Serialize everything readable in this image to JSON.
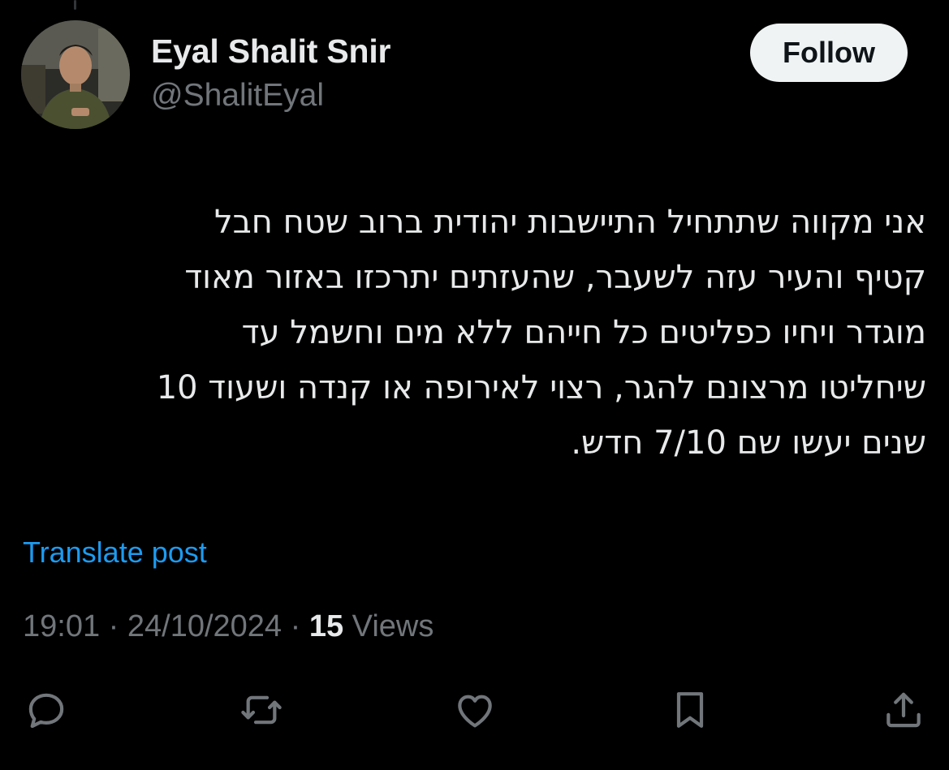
{
  "author": {
    "display_name": "Eyal Shalit Snir",
    "handle": "@ShalitEyal"
  },
  "follow_button": {
    "label": "Follow"
  },
  "post": {
    "direction": "rtl",
    "lines": [
      "אני מקווה שתתחיל התיישבות יהודית ברוב שטח חבל",
      "קטיף והעיר עזה לשעבר, שהעזתים יתרכזו באזור מאוד",
      "מוגדר ויחיו כפליטים כל חייהם ללא מים וחשמל עד",
      "שיחליטו מרצונם להגר, רצוי לאירופה או קנדה ושעוד 10",
      "שנים יעשו שם 7/10 חדש."
    ]
  },
  "translate": {
    "label": "Translate post"
  },
  "meta": {
    "time": "19:01",
    "separator": " · ",
    "date": "24/10/2024",
    "views_count": "15",
    "views_label": " Views"
  },
  "actions": [
    {
      "name": "reply",
      "icon": "reply-icon"
    },
    {
      "name": "repost",
      "icon": "repost-icon"
    },
    {
      "name": "like",
      "icon": "heart-icon"
    },
    {
      "name": "bookmark",
      "icon": "bookmark-icon"
    },
    {
      "name": "share",
      "icon": "share-icon"
    }
  ],
  "colors": {
    "background": "#000000",
    "primary_text": "#e7e9ea",
    "secondary_text": "#71767b",
    "link": "#1d9bf0",
    "follow_bg": "#eff3f4"
  }
}
